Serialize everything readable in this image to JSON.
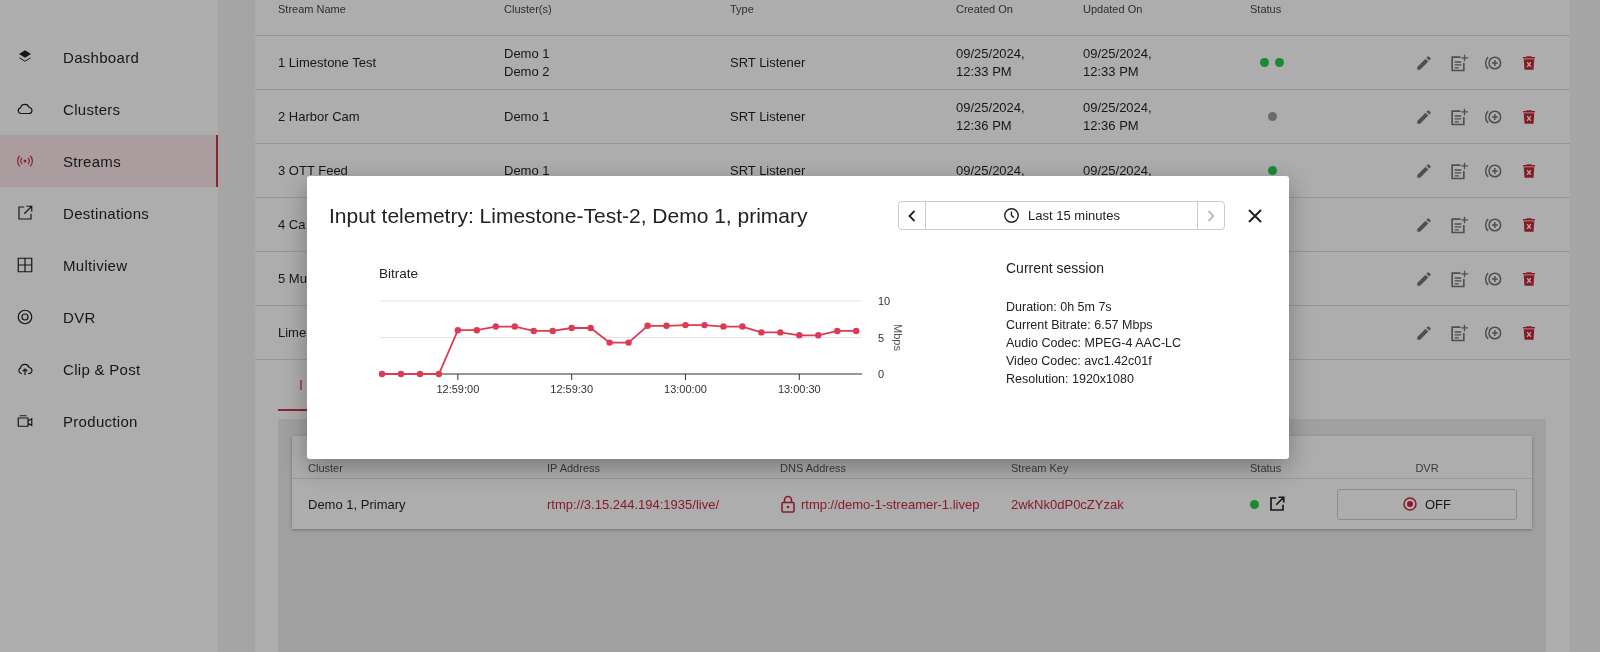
{
  "sidebar": {
    "items": [
      {
        "label": "Dashboard",
        "selected": false
      },
      {
        "label": "Clusters",
        "selected": false
      },
      {
        "label": "Streams",
        "selected": true
      },
      {
        "label": "Destinations",
        "selected": false
      },
      {
        "label": "Multiview",
        "selected": false
      },
      {
        "label": "DVR",
        "selected": false
      },
      {
        "label": "Clip & Post",
        "selected": false
      },
      {
        "label": "Production",
        "selected": false
      }
    ]
  },
  "streams_table": {
    "columns": [
      "Stream Name",
      "Cluster(s)",
      "Type",
      "Created On",
      "Updated On",
      "Status"
    ],
    "rows": [
      {
        "name": "1 Limestone Test",
        "clusters": [
          "Demo 1",
          "Demo 2"
        ],
        "type": "SRT Listener",
        "created": "09/25/2024, 12:33 PM",
        "updated": "09/25/2024, 12:33 PM",
        "statuses": [
          {
            "color": "#1a8a32"
          },
          {
            "color": "#1a8a32"
          }
        ]
      },
      {
        "name": "2 Harbor Cam",
        "clusters": [
          "Demo 1"
        ],
        "type": "SRT Listener",
        "created": "09/25/2024, 12:36 PM",
        "updated": "09/25/2024, 12:36 PM",
        "statuses": [
          {
            "color": "#6a6a6a"
          }
        ]
      },
      {
        "name": "3 OTT Feed",
        "clusters": [
          "Demo 1"
        ],
        "type": "SRT Listener",
        "created": "09/25/2024,",
        "updated": "09/25/2024,",
        "statuses": [
          {
            "color": "#1a8a32"
          }
        ]
      },
      {
        "name": "4 Ca"
      },
      {
        "name": "5 Mu"
      },
      {
        "name": "Lime"
      }
    ]
  },
  "detail_tabs": [
    {
      "label": "I",
      "selected": true
    }
  ],
  "endpoints_table": {
    "columns": [
      "Cluster",
      "IP Address",
      "DNS Address",
      "Stream Key",
      "Status",
      "DVR"
    ],
    "rows": [
      {
        "cluster": "Demo 1, Primary",
        "ip_address": "rtmp://3.15.244.194:1935/live/",
        "dns_address": "rtmp://demo-1-streamer-1.livep",
        "stream_key": "2wkNk0dP0cZYzak",
        "status": {
          "color": "#1a8a32"
        },
        "dvr": "OFF"
      }
    ]
  },
  "modal": {
    "title": "Input telemetry: Limestone-Test-2, Demo 1, primary",
    "time_range": {
      "label": "Last 15 minutes",
      "prev_disabled": false,
      "next_disabled": true
    },
    "chart_data": {
      "type": "line",
      "title": "Bitrate",
      "ylabel": "Mbps",
      "ylim": [
        0,
        10
      ],
      "yticks": [
        0,
        5,
        10
      ],
      "categories": [
        null,
        null,
        null,
        null,
        "12:59:00",
        null,
        null,
        null,
        null,
        null,
        "12:59:30",
        null,
        null,
        null,
        null,
        null,
        "13:00:00",
        null,
        null,
        null,
        null,
        null,
        "13:00:30",
        null,
        null,
        null
      ],
      "series": [
        {
          "color": "#dd3a55",
          "marker": "circle",
          "values": [
            0,
            0,
            0,
            0,
            6.0,
            6.0,
            6.5,
            6.5,
            5.9,
            5.9,
            6.3,
            6.3,
            4.3,
            4.3,
            6.6,
            6.6,
            6.7,
            6.7,
            6.5,
            6.5,
            5.7,
            5.7,
            5.3,
            5.3,
            5.9,
            5.9
          ]
        }
      ]
    },
    "session": {
      "title": "Current session",
      "lines": [
        "Duration: 0h 5m 7s",
        "Current Bitrate: 6.57 Mbps",
        "Audio Codec: MPEG-4 AAC-LC",
        "Video Codec: avc1.42c01f",
        "Resolution: 1920x1080"
      ]
    }
  }
}
